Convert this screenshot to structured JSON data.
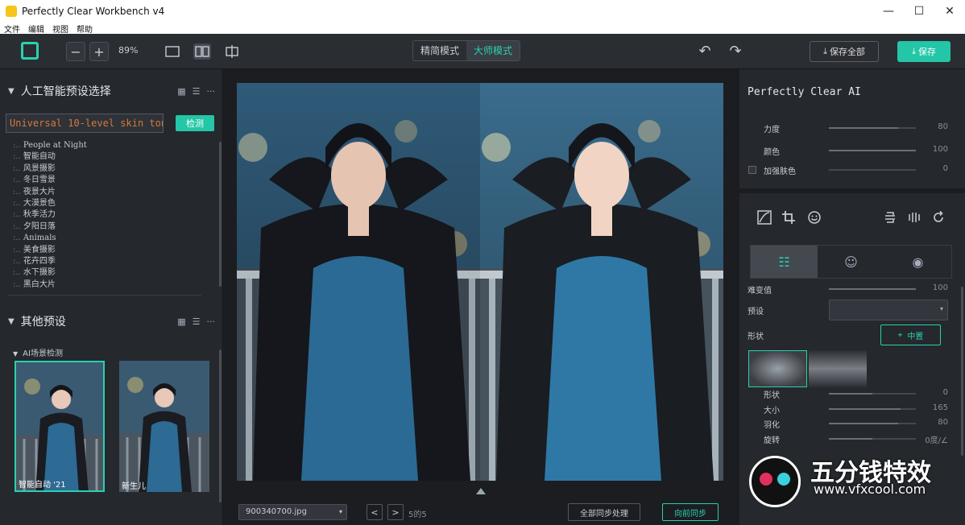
{
  "window": {
    "title": "Perfectly Clear Workbench v4",
    "minimize": "—",
    "maximize": "☐",
    "close": "✕"
  },
  "menu": [
    "文件",
    "编辑",
    "视图",
    "帮助"
  ],
  "toolbar": {
    "zoom_out": "−",
    "zoom_in": "+",
    "zoom_level": "89%",
    "mode_simple": "精简模式",
    "mode_master": "大师模式",
    "undo": "↶",
    "redo": "↷",
    "save_all": "保存全部",
    "save": "保存"
  },
  "left": {
    "ai_section_title": "人工智能预设选择",
    "search_value": "Universal 10-level skin tone",
    "detect_button": "检测",
    "tree_items": [
      "People at Night",
      "智能自动",
      "风景摄影",
      "冬日雪景",
      "夜景大片",
      "大漠景色",
      "秋季活力",
      "夕阳日落",
      "Animals",
      "美食摄影",
      "花卉四季",
      "水下摄影",
      "黑白大片"
    ],
    "other_section_title": "其他预设",
    "scene_detect_label": "AI场景检测",
    "thumbs": [
      {
        "label": "智能自动 '21",
        "selected": true
      },
      {
        "label": "新生儿",
        "selected": false
      }
    ]
  },
  "center": {
    "file_name": "900340700.jpg",
    "prev": "<",
    "next": ">",
    "page_count": "5的5",
    "sync_all": "全部同步处理",
    "sync_forward": "向前同步"
  },
  "right": {
    "ai_title": "Perfectly Clear AI",
    "sliders_top": [
      {
        "name": "力度",
        "value": "80",
        "level": 0.8
      },
      {
        "name": "颜色",
        "value": "100",
        "level": 1.0
      },
      {
        "name": "加强肤色",
        "value": "0",
        "level": 0.0
      }
    ],
    "preset_label": "预设",
    "partial_label": "难变值",
    "partial_value": "100",
    "shape_label": "形状",
    "center_button": "中置",
    "sliders_bottom": [
      {
        "name": "形状",
        "value": "0",
        "level": 0.5
      },
      {
        "name": "大小",
        "value": "165",
        "level": 0.82
      },
      {
        "name": "羽化",
        "value": "80",
        "level": 0.8
      },
      {
        "name": "旋转",
        "value": "0度/∠",
        "level": 0.5
      }
    ]
  },
  "watermark": {
    "text": "五分钱特效",
    "url": "www.vfxcool.com"
  },
  "colors": {
    "accent": "#23c6a6",
    "panel": "#25282d",
    "background": "#1b1d21"
  }
}
